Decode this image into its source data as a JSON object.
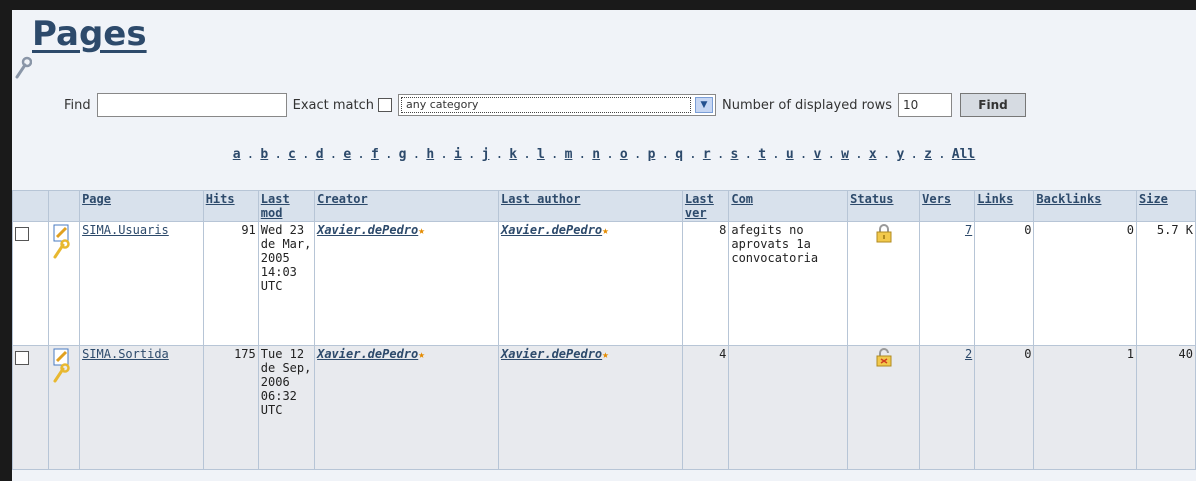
{
  "title": "Pages",
  "find": {
    "find_label": "Find",
    "find_value": "",
    "exact_match_label": "Exact match",
    "category_selected": "any category",
    "rows_label": "Number of displayed rows",
    "rows_value": "10",
    "find_button": "Find"
  },
  "alphabet": [
    "a",
    "b",
    "c",
    "d",
    "e",
    "f",
    "g",
    "h",
    "i",
    "j",
    "k",
    "l",
    "m",
    "n",
    "o",
    "p",
    "q",
    "r",
    "s",
    "t",
    "u",
    "v",
    "w",
    "x",
    "y",
    "z",
    "All"
  ],
  "table": {
    "headers": {
      "page": "Page",
      "hits": "Hits",
      "last_mod": "Last mod",
      "creator": "Creator",
      "last_author": "Last author",
      "last_ver": "Last ver",
      "com": "Com",
      "status": "Status",
      "vers": "Vers",
      "links": "Links",
      "backlinks": "Backlinks",
      "size": "Size"
    },
    "rows": [
      {
        "page": "SIMA.Usuaris",
        "hits": "91",
        "last_mod": "Wed 23 de Mar, 2005 14:03 UTC",
        "creator": "Xavier.dePedro",
        "last_author": "Xavier.dePedro",
        "last_ver": "8",
        "com": "afegits no aprovats 1a convocatoria",
        "status_icon": "lock-closed-icon",
        "vers": "7",
        "links": "0",
        "backlinks": "0",
        "size": "5.7 K"
      },
      {
        "page": "SIMA.Sortida",
        "hits": "175",
        "last_mod": "Tue 12 de Sep, 2006 06:32 UTC",
        "creator": "Xavier.dePedro",
        "last_author": "Xavier.dePedro",
        "last_ver": "4",
        "com": "",
        "status_icon": "lock-open-icon",
        "vers": "2",
        "links": "0",
        "backlinks": "1",
        "size": "40"
      }
    ]
  },
  "colors": {
    "heading": "#2d4a6b",
    "header_bg": "#d8e1ec",
    "star": "#e48b00"
  }
}
